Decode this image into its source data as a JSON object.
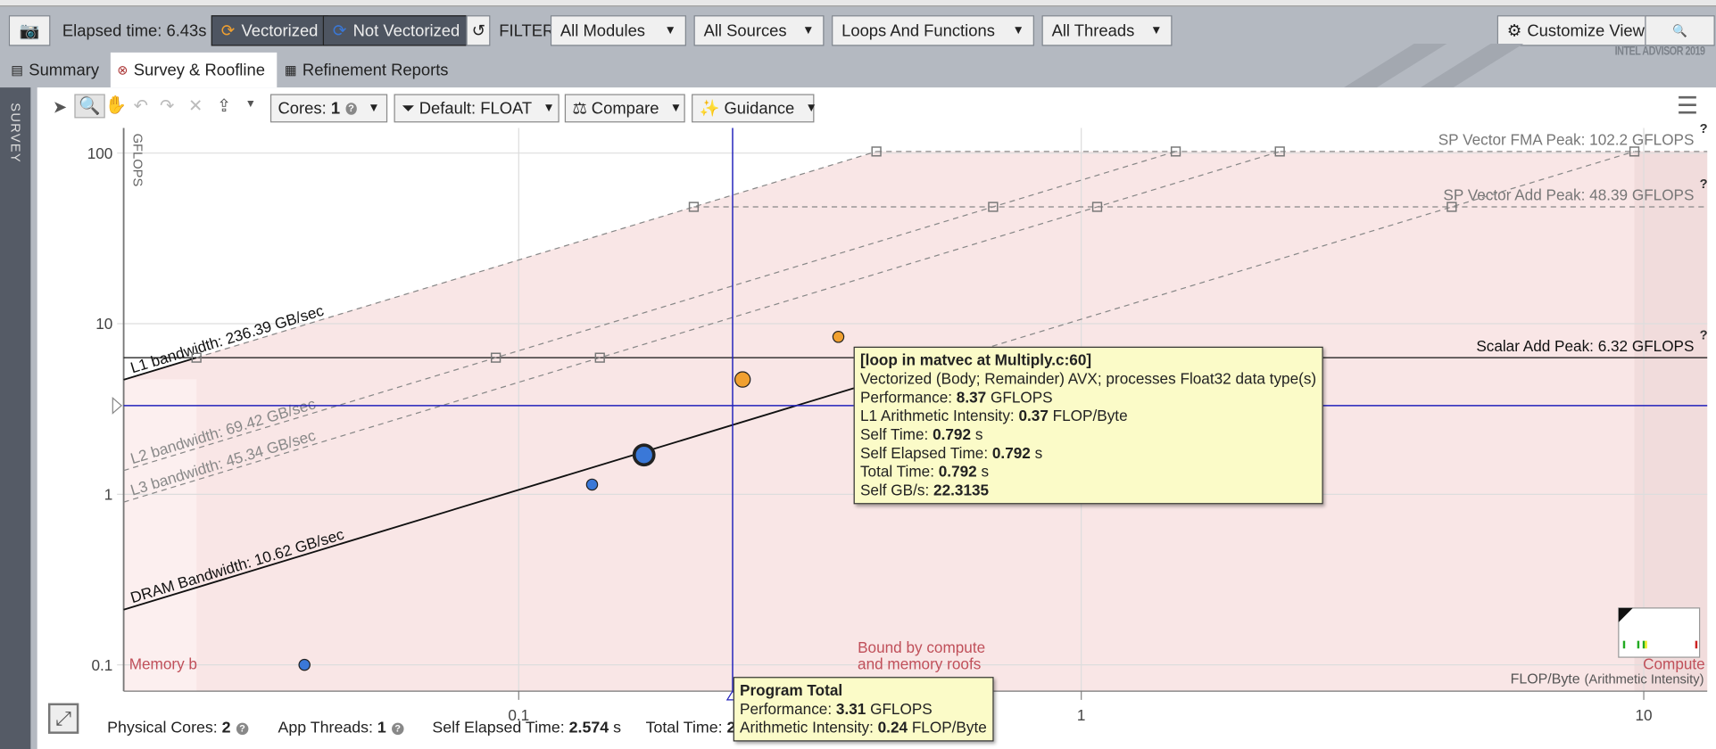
{
  "toolbar": {
    "elapsed": "Elapsed time: 6.43s",
    "vectorized": "Vectorized",
    "not_vectorized": "Not Vectorized",
    "filter_label": "FILTER:",
    "filters": [
      "All Modules",
      "All Sources",
      "Loops And Functions",
      "All Threads"
    ],
    "customize": "Customize View",
    "colors": {
      "vectorized": "#f0a030",
      "not_vectorized": "#3a78d8"
    }
  },
  "tabs": [
    {
      "label": "Summary",
      "active": false
    },
    {
      "label": "Survey & Roofline",
      "active": true
    },
    {
      "label": "Refinement Reports",
      "active": false
    }
  ],
  "brand": "INTEL ADVISOR 2019",
  "sidebar": {
    "label": "SURVEY"
  },
  "chart_toolbar": {
    "cores_label": "Cores:",
    "cores_value": "1",
    "float": "Default: FLOAT",
    "compare": "Compare",
    "guidance": "Guidance"
  },
  "chart_data": {
    "type": "scatter",
    "xscale": "log",
    "yscale": "log",
    "xlabel": "FLOP/Byte",
    "xlabel_sub": "(Arithmetic Intensity)",
    "ylabel": "GFLOPS",
    "xlim": [
      0.02,
      13
    ],
    "ylim": [
      0.069,
      142
    ],
    "xticks": [
      {
        "v": 0.1,
        "label": "0.1"
      },
      {
        "v": 1,
        "label": "1"
      },
      {
        "v": 10,
        "label": "10"
      }
    ],
    "yticks": [
      {
        "v": 0.1,
        "label": "0.1"
      },
      {
        "v": 1,
        "label": "1"
      },
      {
        "v": 10,
        "label": "10"
      },
      {
        "v": 100,
        "label": "100"
      }
    ],
    "grid": true,
    "compute_roofs": [
      {
        "label": "SP Vector FMA Peak: 102.2 GFLOPS",
        "value": 102.2,
        "style": "dashed"
      },
      {
        "label": "SP Vector Add Peak: 48.39 GFLOPS",
        "value": 48.39,
        "style": "dashed"
      },
      {
        "label": "Scalar Add Peak: 6.32 GFLOPS",
        "value": 6.32,
        "style": "solid"
      }
    ],
    "memory_roofs": [
      {
        "label": "L1 bandwidth: 236.39 GB/sec",
        "value": 236.39,
        "style": "solid"
      },
      {
        "label": "L2 bandwidth: 69.42 GB/sec",
        "value": 69.42,
        "style": "dashed"
      },
      {
        "label": "L3 bandwidth: 45.34 GB/sec",
        "value": 45.34,
        "style": "dashed"
      },
      {
        "label": "DRAM Bandwidth: 10.62 GB/sec",
        "value": 10.62,
        "style": "solid"
      }
    ],
    "points": [
      {
        "ai": 0.0416,
        "gflops": 0.1,
        "type": "not_vectorized",
        "size": "small"
      },
      {
        "ai": 0.135,
        "gflops": 1.14,
        "type": "not_vectorized",
        "size": "small"
      },
      {
        "ai": 0.167,
        "gflops": 1.7,
        "type": "not_vectorized",
        "size": "large",
        "selected": true
      },
      {
        "ai": 0.25,
        "gflops": 4.71,
        "type": "vectorized",
        "size": "medium"
      },
      {
        "ai": 0.37,
        "gflops": 8.37,
        "type": "vectorized",
        "size": "small"
      }
    ],
    "crosshair": {
      "ai": 0.24,
      "gflops": 3.31
    },
    "regions": {
      "memory": "Memory b",
      "mixed_line1": "Bound by compute",
      "mixed_line2": "and memory roofs",
      "compute": "Compute"
    },
    "colors": {
      "region_mixed": "#f9e6e6",
      "region_memory": "#fcefef",
      "region_compute": "#f1dcdc",
      "region_text": "#c0505a",
      "crosshair": "#2222bb"
    }
  },
  "tooltip": {
    "title": "[loop in matvec at Multiply.c:60]",
    "desc": "Vectorized (Body; Remainder) AVX; processes Float32 data type(s)",
    "rows": [
      {
        "label": "Performance: ",
        "value": "8.37",
        "unit": " GFLOPS"
      },
      {
        "label": "L1 Arithmetic Intensity: ",
        "value": "0.37",
        "unit": " FLOP/Byte"
      },
      {
        "label": "Self Time: ",
        "value": "0.792",
        "unit": " s"
      },
      {
        "label": "Self Elapsed Time: ",
        "value": "0.792",
        "unit": " s"
      },
      {
        "label": "Total Time: ",
        "value": "0.792",
        "unit": " s"
      },
      {
        "label": "Self GB/s: ",
        "value": "22.3135",
        "unit": ""
      }
    ]
  },
  "program_total": {
    "title": "Program Total",
    "rows": [
      {
        "label": "Performance: ",
        "value": "3.31",
        "unit": " GFLOPS"
      },
      {
        "label": "Arithmetic Intensity: ",
        "value": "0.24",
        "unit": " FLOP/Byte"
      }
    ]
  },
  "footer": {
    "physical_cores_label": "Physical Cores: ",
    "physical_cores": "2",
    "app_threads_label": "App Threads: ",
    "app_threads": "1",
    "self_elapsed_label": "Self Elapsed Time: ",
    "self_elapsed": "2.574",
    "self_elapsed_unit": " s",
    "total_time_label": "Total Time: ",
    "total_time": "2"
  }
}
